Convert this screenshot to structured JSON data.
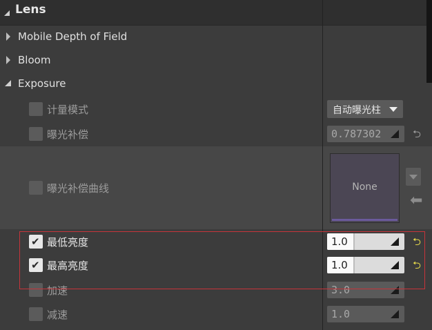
{
  "section": {
    "title": "Lens"
  },
  "categories": [
    {
      "label": "Mobile Depth of Field"
    },
    {
      "label": "Bloom"
    },
    {
      "label": "Exposure"
    }
  ],
  "props": {
    "metering": {
      "label": "计量模式",
      "value": "自动曝光柱"
    },
    "comp": {
      "label": "曝光补偿",
      "value": "0.787302"
    },
    "curve": {
      "label": "曝光补偿曲线",
      "value": "None"
    },
    "minb": {
      "label": "最低亮度",
      "value": "1.0"
    },
    "maxb": {
      "label": "最高亮度",
      "value": "1.0"
    },
    "speedup": {
      "label": "加速",
      "value": "3.0"
    },
    "speeddown": {
      "label": "减速",
      "value": "1.0"
    }
  },
  "icons": {
    "check": "✔",
    "reset": "⮌",
    "arrow_left": "⬅"
  },
  "colors": {
    "highlight": "#c8343a",
    "reset_active": "#e3d64a",
    "reset_inactive": "#9a9a9a"
  }
}
